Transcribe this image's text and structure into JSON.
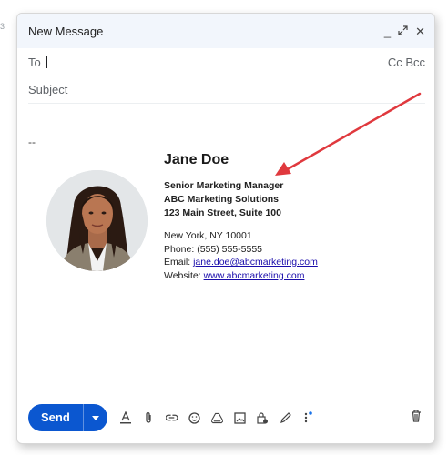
{
  "window": {
    "title": "New Message"
  },
  "to": {
    "label": "To",
    "cc_bcc": "Cc Bcc"
  },
  "subject": {
    "placeholder": "Subject"
  },
  "body": {
    "separator": "--",
    "signature": {
      "name": "Jane Doe",
      "title": "Senior Marketing Manager",
      "company": "ABC Marketing Solutions",
      "address1": "123 Main Street, Suite 100",
      "address2": "New York, NY 10001",
      "phone": "Phone: (555) 555-5555",
      "email_label": "Email: ",
      "email": "jane.doe@abcmarketing.com",
      "website_label": "Website: ",
      "website": "www.abcmarketing.com"
    }
  },
  "toolbar": {
    "send_label": "Send",
    "icons": [
      "format-text-icon",
      "attach-icon",
      "link-icon",
      "emoji-icon",
      "drive-icon",
      "photo-icon",
      "confidential-lock-icon",
      "signature-pen-icon",
      "more-options-icon",
      "trash-icon"
    ]
  },
  "colors": {
    "send": "#0b57d0",
    "arrow": "#e0393e",
    "link": "#1a0dab",
    "titlebar": "#f2f6fc"
  }
}
